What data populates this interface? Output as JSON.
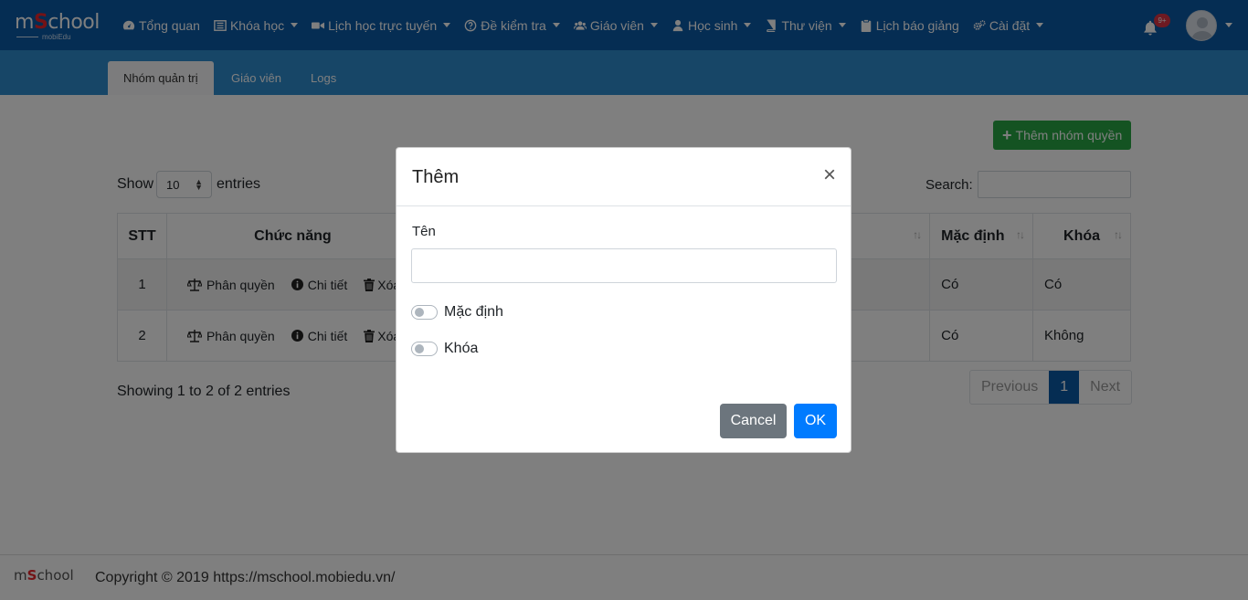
{
  "brand": {
    "name_pre": "m",
    "name_s": "S",
    "name_post": "chool",
    "sub": "mobiEdu"
  },
  "nav": {
    "items": [
      {
        "label": "Tổng quan",
        "icon": "dashboard-icon",
        "dropdown": false
      },
      {
        "label": "Khóa học",
        "icon": "list-icon",
        "dropdown": true
      },
      {
        "label": "Lịch học trực tuyến",
        "icon": "video-icon",
        "dropdown": true
      },
      {
        "label": "Đề kiểm tra",
        "icon": "question-circle-icon",
        "dropdown": true
      },
      {
        "label": "Giáo viên",
        "icon": "users-icon",
        "dropdown": true
      },
      {
        "label": "Học sinh",
        "icon": "user-icon",
        "dropdown": true
      },
      {
        "label": "Thư viện",
        "icon": "book-icon",
        "dropdown": true
      },
      {
        "label": "Lịch báo giảng",
        "icon": "clipboard-icon",
        "dropdown": false
      },
      {
        "label": "Cài đặt",
        "icon": "cogs-icon",
        "dropdown": true
      }
    ],
    "notification_badge": "9+"
  },
  "tabs": [
    {
      "label": "Nhóm quản trị",
      "active": true
    },
    {
      "label": "Giáo viên",
      "active": false
    },
    {
      "label": "Logs",
      "active": false
    }
  ],
  "toolbar": {
    "add_label": "Thêm nhóm quyền"
  },
  "datatable": {
    "show_label": "Show",
    "show_value": "10",
    "entries_label": "entries",
    "search_label": "Search:",
    "columns": [
      "STT",
      "Chức năng",
      "",
      "Mặc định",
      "Khóa"
    ],
    "action_labels": {
      "permission": "Phân quyền",
      "detail": "Chi tiết",
      "delete": "Xóa"
    },
    "rows": [
      {
        "stt": "1",
        "default": "Có",
        "locked": "Có"
      },
      {
        "stt": "2",
        "default": "Có",
        "locked": "Không"
      }
    ],
    "info": "Showing 1 to 2 of 2 entries",
    "pagination": {
      "previous": "Previous",
      "current": "1",
      "next": "Next"
    }
  },
  "footer": {
    "text": "Copyright © 2019 https://mschool.mobiedu.vn/"
  },
  "modal": {
    "title": "Thêm",
    "close_symbol": "×",
    "name_label": "Tên",
    "name_value": "",
    "toggle_default_label": "Mặc định",
    "toggle_default_on": false,
    "toggle_lock_label": "Khóa",
    "toggle_lock_on": false,
    "cancel_label": "Cancel",
    "ok_label": "OK"
  },
  "colors": {
    "navbar": "#0b5aa6",
    "subnav": "#2e8ccf",
    "success": "#28a745",
    "primary": "#007bff",
    "secondary": "#6c757d",
    "danger": "#dc3545"
  }
}
